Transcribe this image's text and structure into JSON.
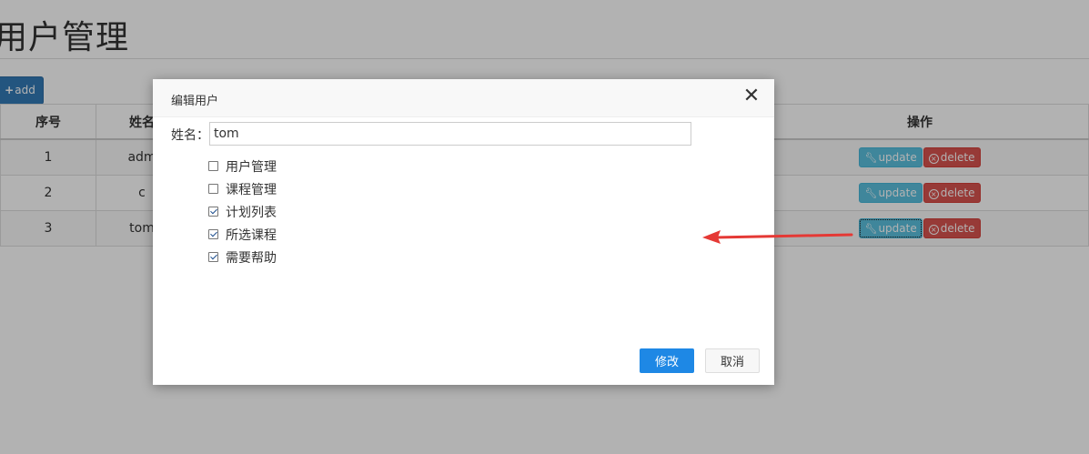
{
  "page": {
    "title": "用户管理",
    "add_button": {
      "icon": "plus-icon",
      "label": "add"
    }
  },
  "table": {
    "headers": [
      "序号",
      "姓名",
      "操作"
    ],
    "rows": [
      {
        "idx": "1",
        "name": "adm"
      },
      {
        "idx": "2",
        "name": "c"
      },
      {
        "idx": "3",
        "name": "tom"
      }
    ],
    "update_label": "update",
    "delete_label": "delete"
  },
  "dialog": {
    "title": "编辑用户",
    "close_icon": "close-icon",
    "name_label": "姓名：",
    "name_value": "tom",
    "permissions": [
      {
        "label": "用户管理",
        "checked": false
      },
      {
        "label": "课程管理",
        "checked": false
      },
      {
        "label": "计划列表",
        "checked": true
      },
      {
        "label": "所选课程",
        "checked": true
      },
      {
        "label": "需要帮助",
        "checked": true
      }
    ],
    "save_label": "修改",
    "cancel_label": "取消"
  },
  "colors": {
    "primary": "#337ab7",
    "info": "#5bc0de",
    "danger": "#d9534f",
    "dialog_primary": "#1e88e5",
    "annotation_arrow": "#e53935"
  }
}
